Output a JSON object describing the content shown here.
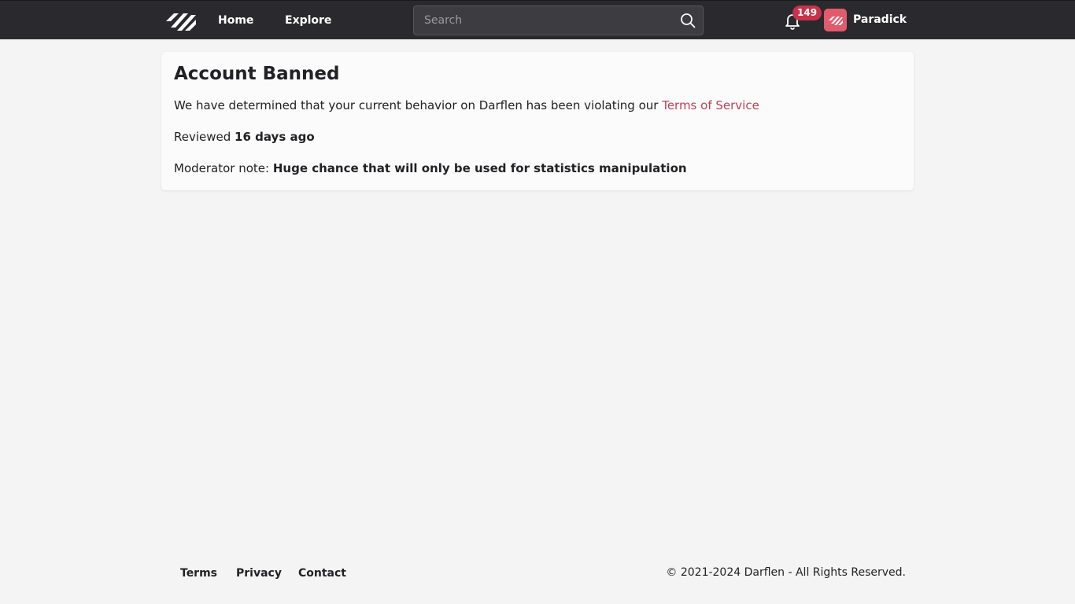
{
  "header": {
    "nav": {
      "home": "Home",
      "explore": "Explore"
    },
    "search": {
      "placeholder": "Search",
      "value": ""
    },
    "notifications": {
      "count": "149"
    },
    "user": {
      "name": "Paradick"
    }
  },
  "main": {
    "title": "Account Banned",
    "message": "We have determined that your current behavior on Darflen has been violating our ",
    "tos_link": "Terms of Service",
    "reviewed_label": "Reviewed ",
    "reviewed_value": "16 days ago",
    "note_label": "Moderator note: ",
    "note_value": "Huge chance that will only be used for statistics manipulation"
  },
  "footer": {
    "links": {
      "terms": "Terms",
      "privacy": "Privacy",
      "contact": "Contact"
    },
    "copyright": "© 2021-2024 Darflen - All Rights Reserved."
  },
  "colors": {
    "topbar": "#2a2a2e",
    "accent": "#c0405a",
    "badge": "#c8324a",
    "avatar": "#e25b6c",
    "background": "#f4f4f4"
  },
  "icons": [
    "darflen-logo-icon",
    "search-icon",
    "bell-icon",
    "avatar-logo-icon"
  ]
}
